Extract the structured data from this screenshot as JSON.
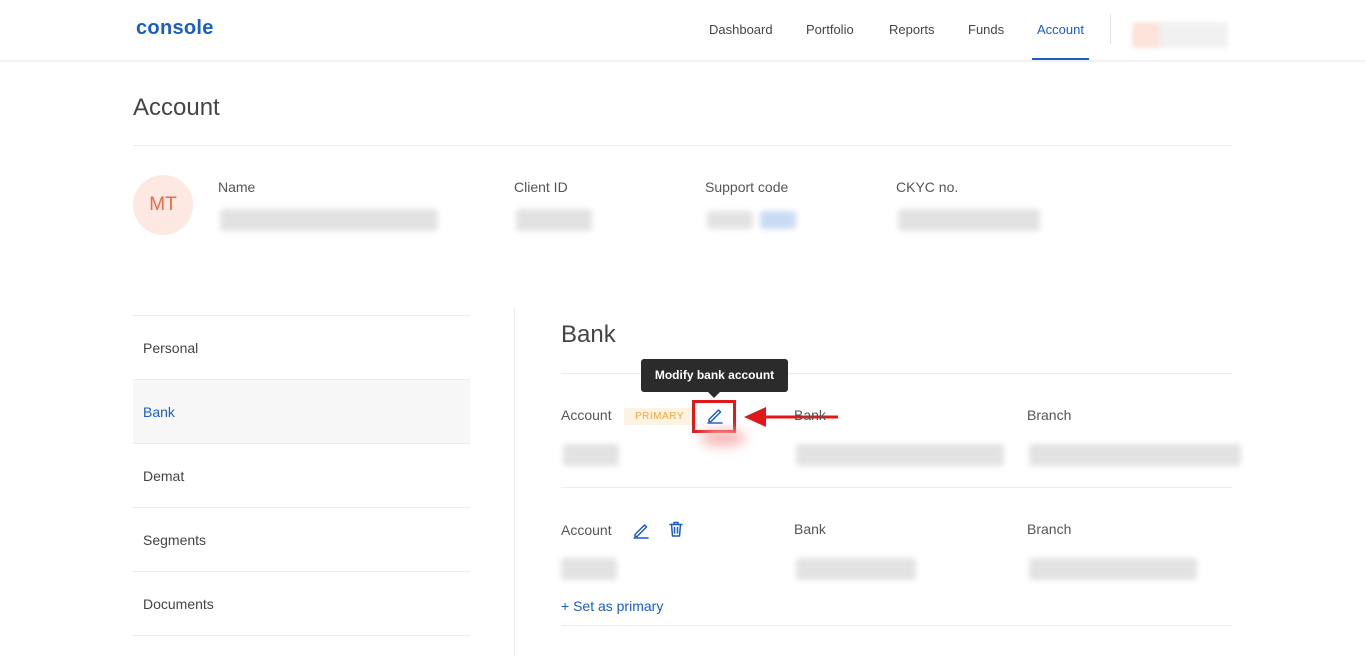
{
  "header": {
    "logo": "console",
    "nav": [
      "Dashboard",
      "Portfolio",
      "Reports",
      "Funds",
      "Account"
    ],
    "active_nav": "Account"
  },
  "page": {
    "title": "Account"
  },
  "profile": {
    "initials": "MT",
    "name_label": "Name",
    "client_id_label": "Client ID",
    "support_code_label": "Support code",
    "ckyc_label": "CKYC no."
  },
  "sidebar": {
    "items": [
      {
        "label": "Personal"
      },
      {
        "label": "Bank"
      },
      {
        "label": "Demat"
      },
      {
        "label": "Segments"
      },
      {
        "label": "Documents"
      }
    ],
    "active": "Bank"
  },
  "bank": {
    "title": "Bank",
    "tooltip": "Modify bank account",
    "accounts": [
      {
        "account_label": "Account",
        "badge": "PRIMARY",
        "bank_label": "Bank",
        "branch_label": "Branch"
      },
      {
        "account_label": "Account",
        "bank_label": "Bank",
        "branch_label": "Branch",
        "set_primary": "+ Set as primary"
      }
    ]
  },
  "colors": {
    "brand_blue": "#1a5dc5",
    "highlight_red": "#e01818",
    "badge_orange": "#f0a93a",
    "avatar_bg": "#fde8e2"
  },
  "icons": [
    "edit-pencil-icon",
    "trash-icon",
    "arrow-left-icon"
  ]
}
